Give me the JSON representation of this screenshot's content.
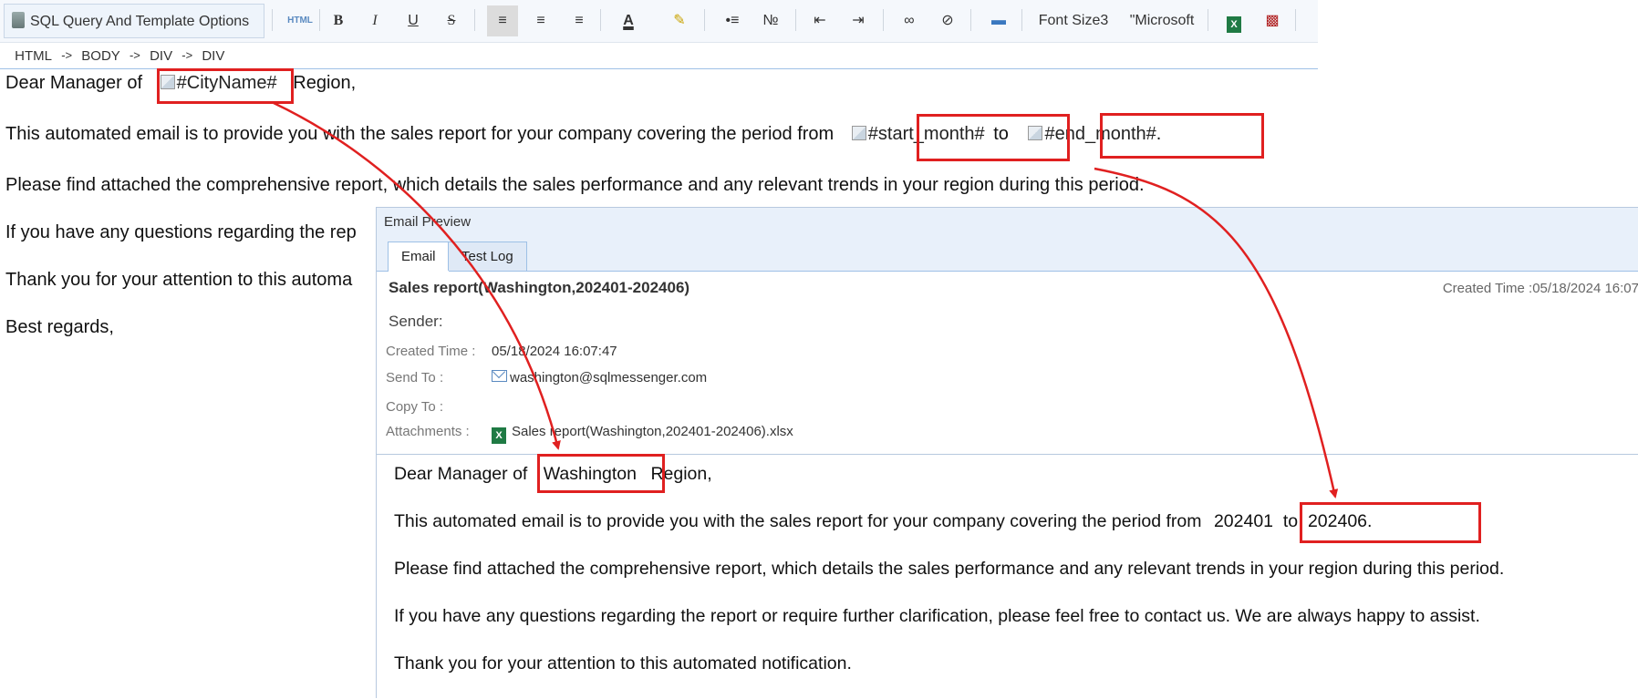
{
  "toolbar": {
    "sql_options_label": "SQL Query And Template Options",
    "font_size_label": "Font Size3",
    "font_name_label": "\"Microsoft",
    "buttons": {
      "html": "HTML",
      "bold": "B",
      "italic": "I",
      "underline": "U",
      "strike": "S",
      "font_color": "A"
    }
  },
  "breadcrumb": {
    "items": [
      "HTML",
      "BODY",
      "DIV",
      "DIV"
    ],
    "separator": "->"
  },
  "editor": {
    "line1_before": "Dear Manager of",
    "line1_placeholder": "#CityName#",
    "line1_after": "Region,",
    "line2_before": "This automated email is to provide you with the sales report for your company covering the period from",
    "line2_placeholder_start": "#start_month#",
    "line2_mid": "to",
    "line2_placeholder_end": "#end_month#",
    "line2_end": ".",
    "line3": "Please find attached the comprehensive report, which details the sales performance and any relevant trends in your region during this period.",
    "line4": "If you have any questions regarding the rep",
    "line5": "Thank you for your attention to this automa",
    "line6": "Best regards,"
  },
  "preview": {
    "window_title": "Email Preview",
    "tabs": [
      "Email",
      "Test Log"
    ],
    "subject": "Sales report(Washington,202401-202406)",
    "created_time_right": "Created Time :05/18/2024 16:07",
    "sender_label": "Sender:",
    "created_time_label": "Created Time :",
    "created_time_value": "05/18/2024 16:07:47",
    "send_to_label": "Send To :",
    "send_to_value": "washington@sqlmessenger.com",
    "copy_to_label": "Copy To :",
    "attachments_label": "Attachments :",
    "attachment_name": "Sales report(Washington,202401-202406).xlsx",
    "body": {
      "line1_before": "Dear Manager of",
      "city": "Washington",
      "line1_after": "Region,",
      "line2_before": "This automated email is to provide you with the sales report for your company covering the period from",
      "period": "202401  to  202406.",
      "line3": "Please find attached the comprehensive report, which details the sales performance and any relevant trends in your region during this period.",
      "line4": "If you have any questions regarding the report or require further clarification, please feel free to contact us. We are always happy to assist.",
      "line5": "Thank you for your attention to this automated notification."
    }
  },
  "colors": {
    "highlight_box": "#e02020",
    "arrow": "#e02020",
    "toolbar_bg": "#f5f8fc",
    "preview_header_bg": "#e8f0fa"
  }
}
